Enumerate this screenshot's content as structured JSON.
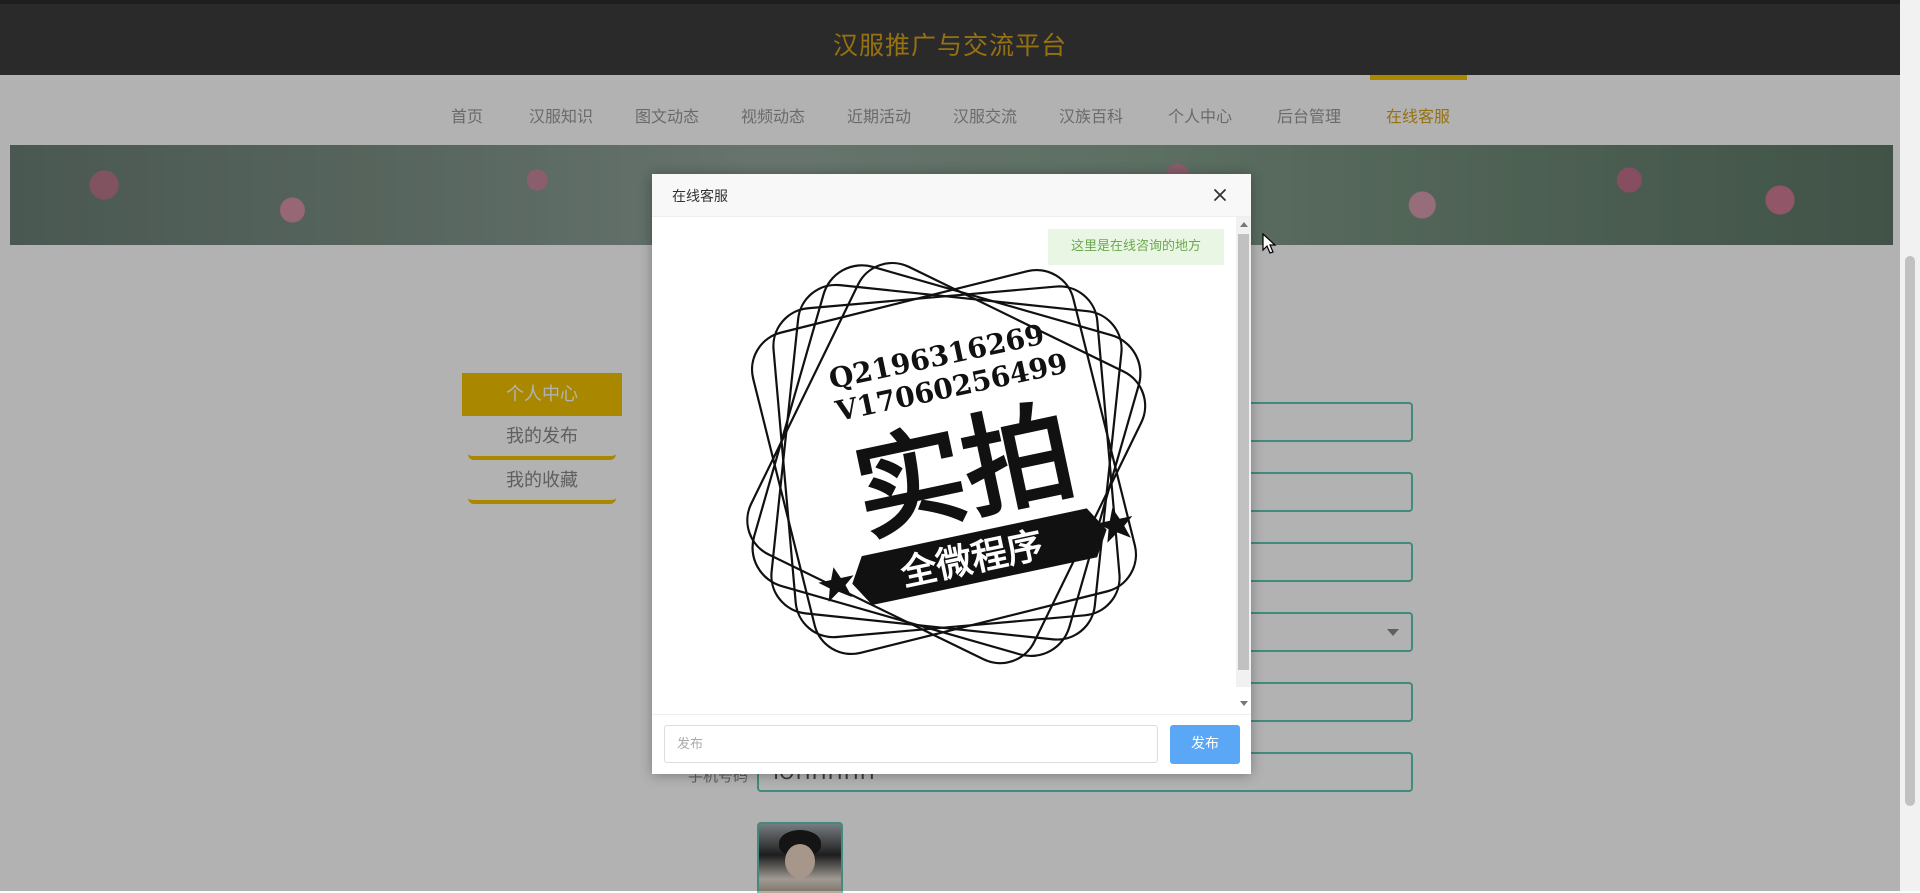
{
  "site": {
    "title": "汉服推广与交流平台"
  },
  "nav": {
    "items": [
      "首页",
      "汉服知识",
      "图文动态",
      "视频动态",
      "近期活动",
      "汉服交流",
      "汉族百科",
      "个人中心",
      "后台管理",
      "在线客服"
    ],
    "active_index": 9
  },
  "sidebar": {
    "header": "个人中心",
    "items": [
      "我的发布",
      "我的收藏"
    ]
  },
  "form": {
    "visible_value": "ЮППППП",
    "partial_label": "手机号码"
  },
  "modal": {
    "title": "在线客服",
    "greeting": "这里是在线咨询的地方",
    "stamp": {
      "line1": "Q2196316269",
      "line2": "V17060256499",
      "main": "实拍",
      "ribbon": "全微程序"
    },
    "input_placeholder": "发布",
    "send_label": "发布"
  },
  "colors": {
    "accent": "#f3c300",
    "title_gold": "#d6a319",
    "send_blue": "#5aa8f5",
    "field_border": "#5ec7b4",
    "topbar": "#3d3d3d"
  },
  "icons": [
    "close-icon",
    "cursor-icon"
  ]
}
